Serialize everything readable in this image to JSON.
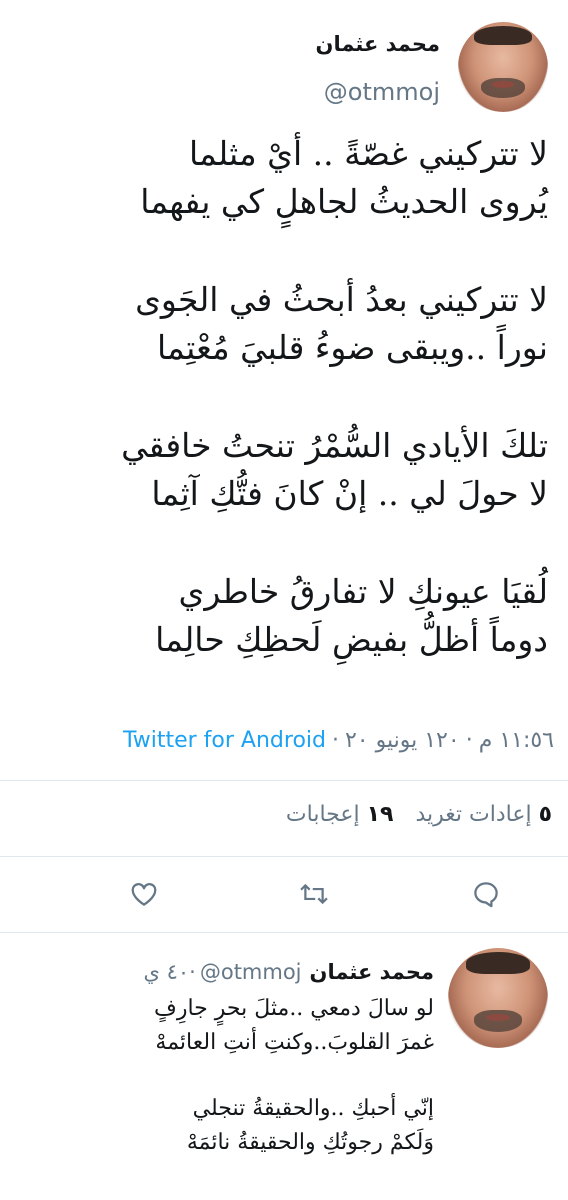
{
  "tweet": {
    "author_name": "محمد عثمان",
    "author_handle": "@otmmoj",
    "stanzas": [
      [
        "لا تتركيني غصّةً .. أيْ مثلما",
        "يُروى الحديثُ لجاهلٍ كي يفهما"
      ],
      [
        "لا تتركيني بعدُ أبحثُ في الجَوى",
        "نوراً ..ويبقى ضوءُ قلبيَ مُعْتِما"
      ],
      [
        "تلكَ الأيادي السُّمْرُ تنحتُ خافقي",
        "لا حولَ لي  .. إنْ كانَ فتُّكِ آثِما"
      ],
      [
        "لُقيَا عيونكِ لا تفارقُ خاطري",
        "دوماً أظلُّ بفيضِ لَحظِكِ حالِما"
      ]
    ],
    "time": "١١:٥٦ م",
    "date": "١٢٠ يونيو ٢٠",
    "source": "Twitter for Android",
    "separator": "·"
  },
  "stats": {
    "retweets_count": "٥",
    "retweets_label": "إعادات تغريد",
    "likes_count": "١٩",
    "likes_label": "إعجابات"
  },
  "actions": {
    "reply_icon": "reply-icon",
    "retweet_icon": "retweet-icon",
    "like_icon": "like-icon"
  },
  "reply": {
    "author_name": "محمد عثمان",
    "author_handle": "@otmmoj",
    "time_ago": "٤٠ ي",
    "separator": "·",
    "stanzas": [
      [
        "لو سالَ دمعي ..مثلَ بحرٍ جارِفٍ",
        "غمرَ القلوبَ..وكنتِ أنتِ العائمهْ"
      ],
      [
        "إنّي أحبكِ ..والحقيقةُ تنجلي",
        "وَلَكمْ رجوتُكِ والحقيقةُ نائمَهْ"
      ]
    ]
  },
  "colors": {
    "text": "#14171a",
    "secondary": "#657786",
    "link": "#1da1f2",
    "divider": "#e1e8ed"
  }
}
